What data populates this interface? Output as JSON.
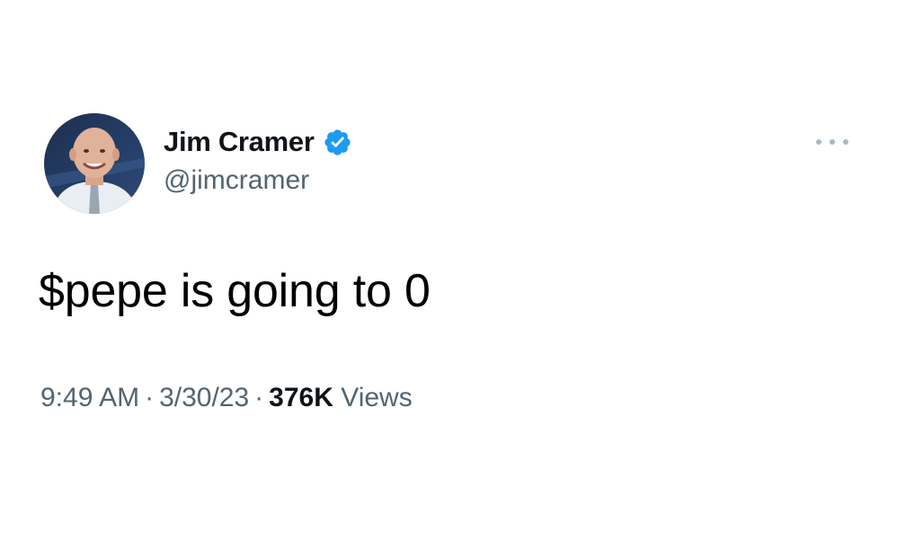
{
  "author": {
    "display_name": "Jim Cramer",
    "handle": "@jimcramer",
    "verified": true
  },
  "tweet": {
    "text": "$pepe is going to 0",
    "time": "9:49 AM",
    "date": "3/30/23",
    "separator": "·",
    "views_count": "376K",
    "views_label": "Views"
  },
  "icons": {
    "verified": "verified-badge-icon",
    "more": "more-options-icon"
  },
  "colors": {
    "verified_blue": "#1d9bf0",
    "secondary_text": "#536471",
    "primary_text": "#0f1419"
  }
}
